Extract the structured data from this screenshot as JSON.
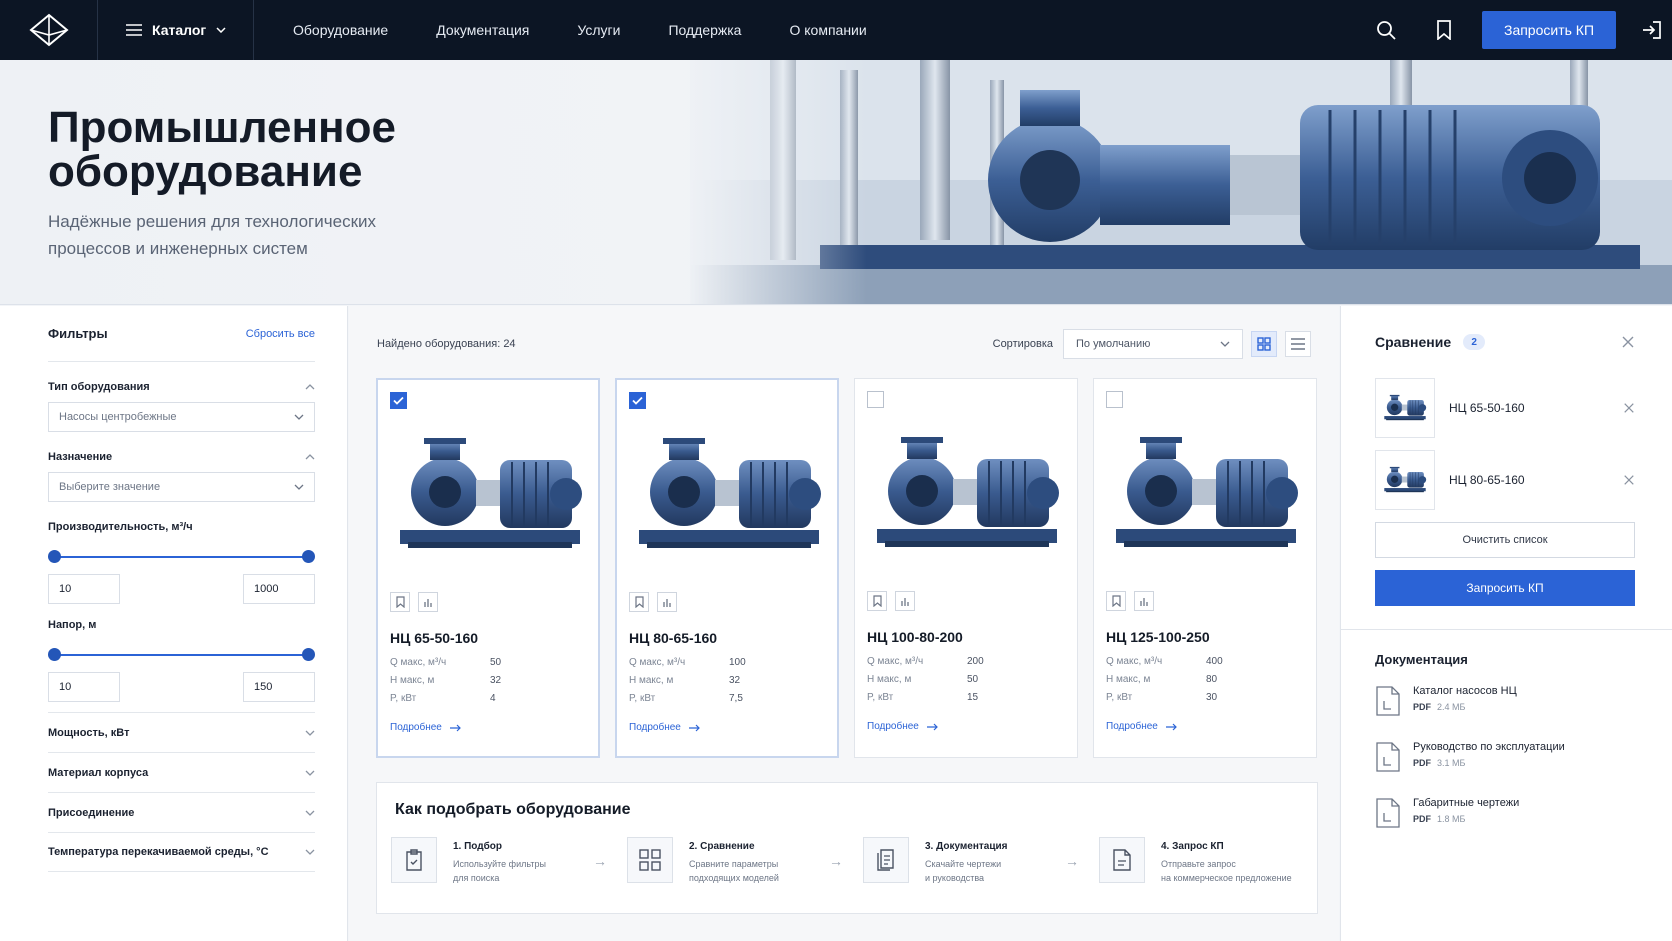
{
  "header": {
    "catalog_label": "Каталог",
    "nav": [
      "Оборудование",
      "Документация",
      "Услуги",
      "Поддержка",
      "О компании"
    ],
    "cta_label": "Запросить КП"
  },
  "hero": {
    "title_line1": "Промышленное",
    "title_line2": "оборудование",
    "subtitle_line1": "Надёжные решения для технологических",
    "subtitle_line2": "процессов и инженерных систем"
  },
  "filters": {
    "title": "Фильтры",
    "reset_label": "Сбросить все",
    "equipment_type": {
      "label": "Тип оборудования",
      "value": "Насосы центробежные"
    },
    "purpose": {
      "label": "Назначение",
      "placeholder": "Выберите значение"
    },
    "capacity": {
      "label": "Производительность, м³/ч",
      "min": "10",
      "max": "1000"
    },
    "head": {
      "label": "Напор, м",
      "min": "10",
      "max": "150"
    },
    "collapsed": [
      "Мощность, кВт",
      "Материал корпуса",
      "Присоединение",
      "Температура перекачиваемой среды, °С"
    ]
  },
  "toolbar": {
    "found_label": "Найдено оборудования: 24",
    "sort_label": "Сортировка",
    "sort_value": "По умолчанию"
  },
  "products": [
    {
      "name": "НЦ 65-50-160",
      "selected": true,
      "q_label": "Q макс, м³/ч",
      "q": "50",
      "h_label": "H макс, м",
      "h": "32",
      "p_label": "P, кВт",
      "p": "4",
      "more": "Подробнее"
    },
    {
      "name": "НЦ 80-65-160",
      "selected": true,
      "q_label": "Q макс, м³/ч",
      "q": "100",
      "h_label": "H макс, м",
      "h": "32",
      "p_label": "P, кВт",
      "p": "7,5",
      "more": "Подробнее"
    },
    {
      "name": "НЦ 100-80-200",
      "selected": false,
      "q_label": "Q макс, м³/ч",
      "q": "200",
      "h_label": "H макс, м",
      "h": "50",
      "p_label": "P, кВт",
      "p": "15",
      "more": "Подробнее"
    },
    {
      "name": "НЦ 125-100-250",
      "selected": false,
      "q_label": "Q макс, м³/ч",
      "q": "400",
      "h_label": "H макс, м",
      "h": "80",
      "p_label": "P, кВт",
      "p": "30",
      "more": "Подробнее"
    }
  ],
  "how": {
    "title": "Как подобрать оборудование",
    "steps": [
      {
        "title": "1. Подбор",
        "desc1": "Используйте фильтры",
        "desc2": "для поиска"
      },
      {
        "title": "2. Сравнение",
        "desc1": "Сравните параметры",
        "desc2": "подходящих моделей"
      },
      {
        "title": "3. Документация",
        "desc1": "Скачайте чертежи",
        "desc2": "и руководства"
      },
      {
        "title": "4. Запрос КП",
        "desc1": "Отправьте запрос",
        "desc2": "на коммерческое предложение"
      }
    ]
  },
  "compare": {
    "title": "Сравнение",
    "count": "2",
    "items": [
      "НЦ 65-50-160",
      "НЦ 80-65-160"
    ],
    "clear_label": "Очистить список",
    "cta_label": "Запросить КП"
  },
  "docs": {
    "title": "Документация",
    "items": [
      {
        "name": "Каталог насосов НЦ",
        "type": "PDF",
        "size": "2.4 МБ"
      },
      {
        "name": "Руководство по эксплуатации",
        "type": "PDF",
        "size": "3.1 МБ"
      },
      {
        "name": "Габаритные чертежи",
        "type": "PDF",
        "size": "1.8 МБ"
      }
    ]
  },
  "colors": {
    "accent": "#2b63d6",
    "topbar": "#0c1524"
  }
}
